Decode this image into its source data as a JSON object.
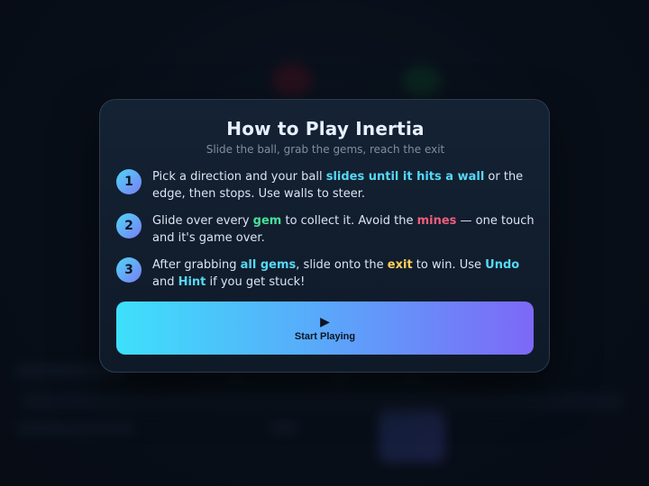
{
  "modal": {
    "title": "How to Play Inertia",
    "subtitle": "Slide the ball, grab the gems, reach the exit"
  },
  "steps": [
    {
      "number": "1",
      "parts": [
        {
          "text": "Pick a direction and your ball ",
          "style": "plain"
        },
        {
          "text": "slides until it hits a wall",
          "style": "cyan"
        },
        {
          "text": " or the edge, then stops. Use walls to steer.",
          "style": "plain"
        }
      ]
    },
    {
      "number": "2",
      "parts": [
        {
          "text": "Glide over every ",
          "style": "plain"
        },
        {
          "text": "gem",
          "style": "green"
        },
        {
          "text": " to collect it. Avoid the ",
          "style": "plain"
        },
        {
          "text": "mines",
          "style": "pink"
        },
        {
          "text": " — one touch and it's game over.",
          "style": "plain"
        }
      ]
    },
    {
      "number": "3",
      "parts": [
        {
          "text": "After grabbing ",
          "style": "plain"
        },
        {
          "text": "all gems",
          "style": "cyan"
        },
        {
          "text": ", slide onto the ",
          "style": "plain"
        },
        {
          "text": "exit",
          "style": "yellow"
        },
        {
          "text": " to win. Use ",
          "style": "plain"
        },
        {
          "text": "Undo",
          "style": "cyan"
        },
        {
          "text": " and ",
          "style": "plain"
        },
        {
          "text": "Hint",
          "style": "cyan"
        },
        {
          "text": " if you get stuck!",
          "style": "plain"
        }
      ]
    }
  ],
  "start_button": {
    "icon": "play-icon",
    "icon_glyph": "▶",
    "label": "Start Playing"
  },
  "colors": {
    "accent_cyan": "#55d8f5",
    "gem_green": "#48e09a",
    "mine_pink": "#f05d7c",
    "exit_yellow": "#ffd05a",
    "button_gradient_start": "#3ee0fb",
    "button_gradient_end": "#7d68f7"
  }
}
